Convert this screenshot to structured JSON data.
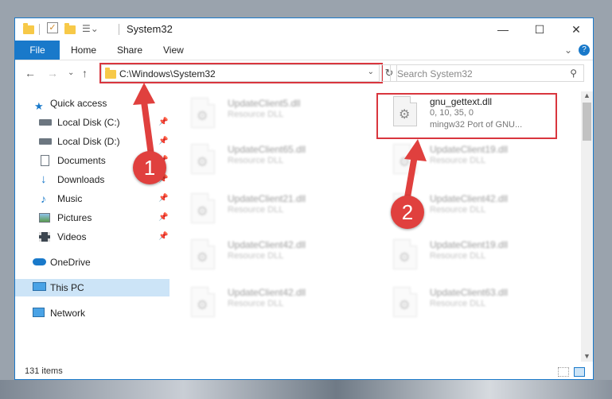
{
  "window": {
    "title": "System32",
    "minimize": "—",
    "maximize": "☐",
    "close": "✕"
  },
  "ribbon": {
    "file": "File",
    "tabs": [
      "Home",
      "Share",
      "View"
    ],
    "collapse": "⌄",
    "help": "?"
  },
  "address": {
    "path": "C:\\Windows\\System32",
    "back": "←",
    "forward": "→",
    "recent": "⌄",
    "up": "↑",
    "refresh": "↻",
    "search_placeholder": "Search System32"
  },
  "nav": {
    "items": [
      {
        "label": "Quick access",
        "pinned": false
      },
      {
        "label": "Local Disk (C:)",
        "pinned": true
      },
      {
        "label": "Local Disk (D:)",
        "pinned": true
      },
      {
        "label": "Documents",
        "pinned": true
      },
      {
        "label": "Downloads",
        "pinned": true
      },
      {
        "label": "Music",
        "pinned": true
      },
      {
        "label": "Pictures",
        "pinned": true
      },
      {
        "label": "Videos",
        "pinned": true
      },
      {
        "label": "OneDrive",
        "pinned": false
      },
      {
        "label": "This PC",
        "pinned": false,
        "selected": true
      },
      {
        "label": "Network",
        "pinned": false
      }
    ],
    "pin_glyph": "📌"
  },
  "files": {
    "highlighted": {
      "name": "gnu_gettext.dll",
      "version": "0, 10, 35, 0",
      "description": "mingw32 Port of GNU..."
    },
    "left_column": [
      {
        "name": "UpdateClient5.dll",
        "type": "Resource DLL"
      },
      {
        "name": "UpdateClient65.dll",
        "type": "Resource DLL"
      },
      {
        "name": "UpdateClient21.dll",
        "type": "Resource DLL"
      },
      {
        "name": "UpdateClient42.dll",
        "type": "Resource DLL"
      },
      {
        "name": "UpdateClient42.dll",
        "type": "Resource DLL"
      }
    ],
    "right_column": [
      {
        "name": "UpdateClient19.dll",
        "type": "Resource DLL"
      },
      {
        "name": "UpdateClient42.dll",
        "type": "Resource DLL"
      },
      {
        "name": "UpdateClient19.dll",
        "type": "Resource DLL"
      },
      {
        "name": "UpdateClient63.dll",
        "type": "Resource DLL"
      }
    ]
  },
  "status": {
    "count": "131 items"
  },
  "callouts": {
    "first": "1",
    "second": "2"
  },
  "colors": {
    "accent": "#1979ca",
    "highlight_red": "#d9363e",
    "callout_red": "#e0403e",
    "selected_nav": "#cce4f7"
  }
}
